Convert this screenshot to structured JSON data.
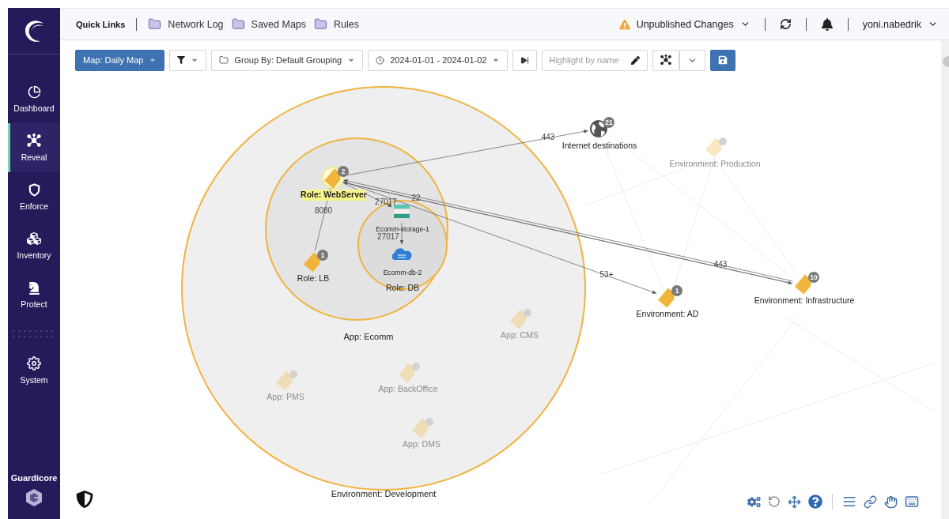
{
  "sidebar": {
    "items": [
      {
        "label": "Dashboard",
        "kind": "pie",
        "selected": false
      },
      {
        "label": "Reveal",
        "kind": "hub",
        "selected": true
      },
      {
        "label": "Enforce",
        "kind": "shield",
        "selected": false
      },
      {
        "label": "Inventory",
        "kind": "cubes",
        "selected": false
      },
      {
        "label": "Protect",
        "kind": "knight",
        "selected": false
      }
    ],
    "system_items": [
      {
        "label": "System",
        "kind": "gear",
        "selected": false
      }
    ],
    "brand": "Guardicore"
  },
  "topbar": {
    "quick_links_label": "Quick Links",
    "links": [
      "Network Log",
      "Saved Maps",
      "Rules"
    ],
    "unpublished": "Unpublished Changes",
    "user": "yoni.nabedrik"
  },
  "toolbar": {
    "map": "Map: Daily Map",
    "group_by": "Group By: Default Grouping",
    "date_range": "2024-01-01 - 2024-01-02",
    "highlight_placeholder": "Highlight by name"
  },
  "map": {
    "groups": [
      {
        "label": "Role: DB"
      },
      {
        "label": "App: Ecomm"
      },
      {
        "label": "Environment: Development"
      }
    ],
    "nodes": [
      {
        "label": "Role: WebServer",
        "kind": "tag",
        "count": "2",
        "faded": false,
        "highlighted": true
      },
      {
        "label": "Role: LB",
        "kind": "tag",
        "count": "1",
        "faded": false,
        "highlighted": false
      },
      {
        "label": "Ecomm-storage-1",
        "kind": "storage",
        "faded": false,
        "highlighted": false
      },
      {
        "label": "Ecomm-db-2",
        "kind": "sql",
        "faded": false,
        "highlighted": false
      },
      {
        "label": "Internet destinations",
        "kind": "globe",
        "count": "21",
        "faded": false,
        "highlighted": false
      },
      {
        "label": "Environment: Production",
        "kind": "tag",
        "faded": true,
        "highlighted": false
      },
      {
        "label": "Environment: AD",
        "kind": "tag",
        "count": "1",
        "faded": false,
        "highlighted": false
      },
      {
        "label": "Environment: Infrastructure",
        "kind": "tag",
        "count": "10",
        "faded": false,
        "highlighted": false
      },
      {
        "label": "App: CMS",
        "kind": "tag",
        "faded": true,
        "highlighted": false
      },
      {
        "label": "App: PMS",
        "kind": "tag",
        "faded": true,
        "highlighted": false
      },
      {
        "label": "App: BackOffice",
        "kind": "tag",
        "faded": true,
        "highlighted": false
      },
      {
        "label": "App: DMS",
        "kind": "tag",
        "faded": true,
        "highlighted": false
      }
    ],
    "edges": [
      {
        "label": "443"
      },
      {
        "label": "8080"
      },
      {
        "label": "27017"
      },
      {
        "label": "22"
      },
      {
        "label": "27017"
      },
      {
        "label": "53+"
      },
      {
        "label": "443"
      }
    ]
  }
}
